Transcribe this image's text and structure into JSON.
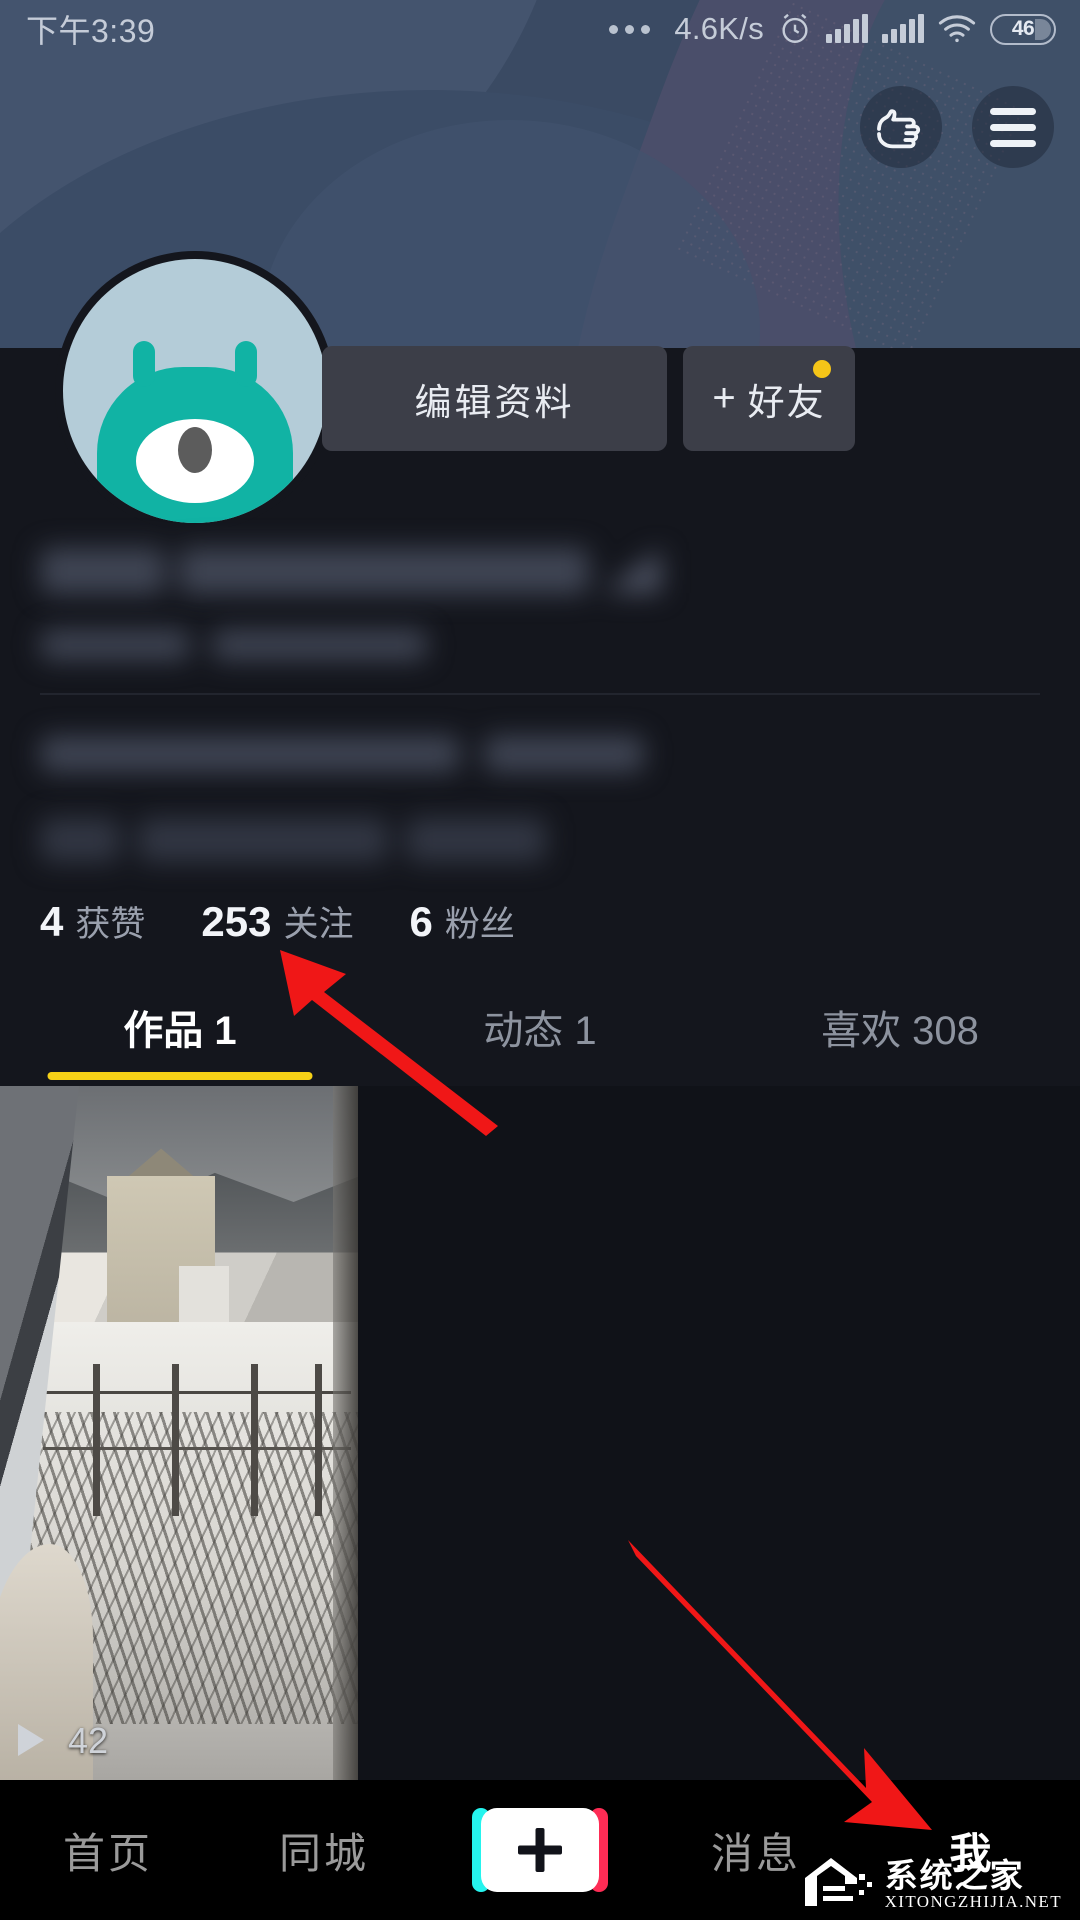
{
  "status_bar": {
    "time": "下午3:39",
    "overflow_icon": "more-dots-icon",
    "network_speed": "4.6K/s",
    "alarm_icon": "alarm-clock-icon",
    "signal1_icon": "cellular-signal-icon",
    "signal2_icon": "cellular-signal-icon",
    "wifi_icon": "wifi-icon",
    "battery_level": "46"
  },
  "header": {
    "pointer_button_icon": "pointing-hand-icon",
    "menu_button_icon": "hamburger-menu-icon"
  },
  "profile": {
    "avatar_icon": "monster-avatar",
    "edit_profile_label": "编辑资料",
    "add_friend_plus": "+",
    "add_friend_label": "好友",
    "add_friend_badge": "notification-dot",
    "username_masked": "",
    "handle_masked": "",
    "bio_masked": "",
    "tags_masked": ""
  },
  "stats": [
    {
      "num": "4",
      "label": "获赞"
    },
    {
      "num": "253",
      "label": "关注"
    },
    {
      "num": "6",
      "label": "粉丝"
    }
  ],
  "tabs": [
    {
      "label": "作品 1",
      "active": true
    },
    {
      "label": "动态 1",
      "active": false
    },
    {
      "label": "喜欢 308",
      "active": false
    }
  ],
  "videos": [
    {
      "play_count": "42",
      "play_icon": "play-triangle-icon",
      "description": "snowy scene through a train window"
    }
  ],
  "bottom_nav": [
    {
      "label": "首页",
      "active": false
    },
    {
      "label": "同城",
      "active": false
    },
    {
      "label": "+",
      "active": false,
      "icon": "create-plus-button"
    },
    {
      "label": "消息",
      "active": false
    },
    {
      "label": "我",
      "active": true
    }
  ],
  "watermark": {
    "cn": "系统之家",
    "en": "XITONGZHIJIA.NET"
  },
  "colors": {
    "banner": "#3a4a63",
    "page_bg": "#14161d",
    "accent_tab": "#f6d117",
    "badge_dot": "#f5c518",
    "avatar_body": "#11b3a4",
    "avatar_bg": "#b4ccd8",
    "annotation_arrow": "#f01717",
    "tiktok_cyan": "#25f4ee",
    "tiktok_pink": "#fe2c55"
  }
}
